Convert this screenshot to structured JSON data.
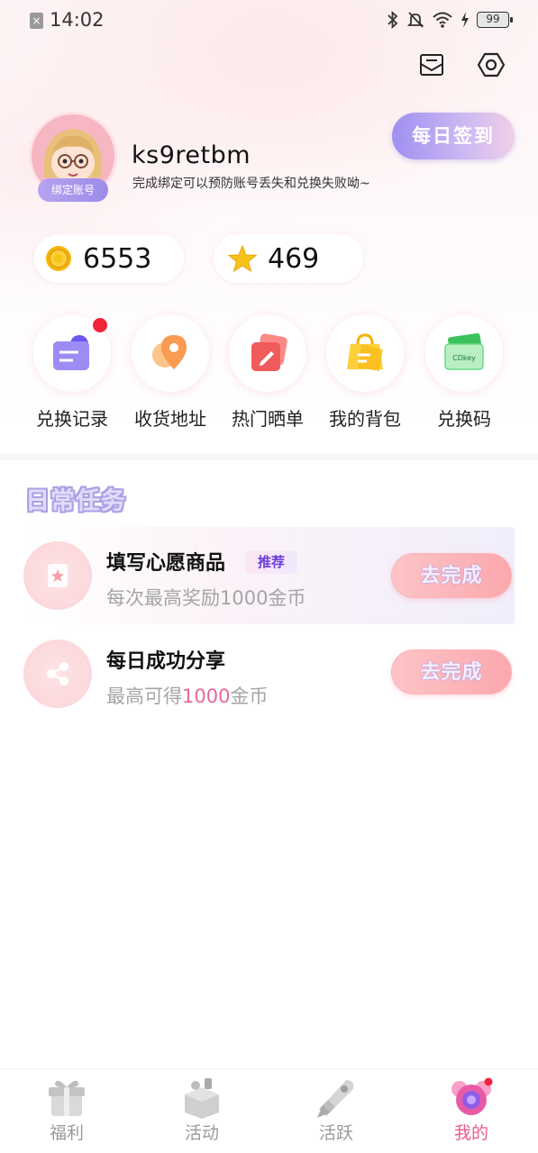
{
  "status_bar": {
    "time": "14:02",
    "battery": "99",
    "icons": [
      "notification-x-icon",
      "bluetooth-icon",
      "bell-muted-icon",
      "wifi-icon",
      "charging-icon",
      "battery-icon"
    ]
  },
  "header": {
    "icons": [
      "mail-icon",
      "settings-icon"
    ]
  },
  "profile": {
    "username": "ks9retbm",
    "bind_badge": "绑定账号",
    "bind_tip": "完成绑定可以预防账号丢失和兑换失败呦~",
    "signin_label": "每日签到"
  },
  "stats": {
    "coins": "6553",
    "stars": "469"
  },
  "quick_actions": [
    {
      "label": "兑换记录",
      "icon": "exchange-record-icon",
      "has_dot": true
    },
    {
      "label": "收货地址",
      "icon": "location-pin-icon",
      "has_dot": false
    },
    {
      "label": "热门晒单",
      "icon": "edit-note-icon",
      "has_dot": false
    },
    {
      "label": "我的背包",
      "icon": "shopping-bag-icon",
      "has_dot": false
    },
    {
      "label": "兑换码",
      "icon": "cdkey-card-icon",
      "has_dot": false
    }
  ],
  "daily_tasks": {
    "title": "日常任务",
    "items": [
      {
        "title": "填写心愿商品",
        "badge": "推荐",
        "desc": "每次最高奖励1000金币",
        "button": "去完成"
      },
      {
        "title": "每日成功分享",
        "desc_prefix": "最高可得",
        "desc_highlight": "1000",
        "desc_suffix": "金币",
        "button": "去完成"
      }
    ]
  },
  "bottom_nav": [
    {
      "label": "福利",
      "icon": "gift-box-icon",
      "active": false
    },
    {
      "label": "活动",
      "icon": "activity-box-icon",
      "active": false
    },
    {
      "label": "活跃",
      "icon": "rocket-icon",
      "active": false
    },
    {
      "label": "我的",
      "icon": "profile-candy-icon",
      "active": true
    }
  ],
  "colors": {
    "accent_pink": "#ef5b8c",
    "signin_purple": "#9f8ff0",
    "red_dot": "#f0243a",
    "highlight_pink": "#e9679a"
  }
}
